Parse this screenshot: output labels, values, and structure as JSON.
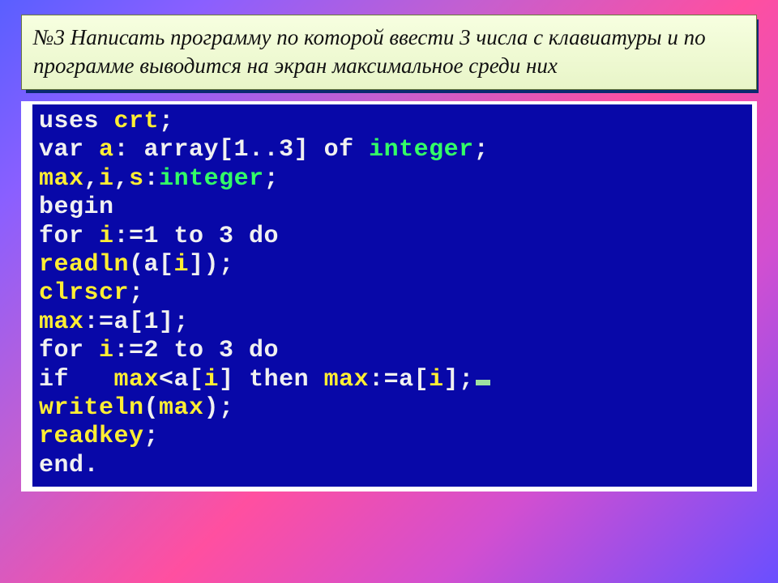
{
  "task": {
    "text": "№3  Написать программу по которой ввести 3 числа с клавиатуры и по программе выводится на экран максимальное среди них"
  },
  "code": {
    "l1_kw1": "uses ",
    "l1_id1": "crt",
    "l1_p": ";",
    "l2_kw1": "var ",
    "l2_id1": "a",
    "l2_kw2": ": array[1..3] of ",
    "l2_typ": "integer",
    "l2_p": ";",
    "l3_id1": "max",
    "l3_p1": ",",
    "l3_id2": "i",
    "l3_p2": ",",
    "l3_id3": "s",
    "l3_p3": ":",
    "l3_typ": "integer",
    "l3_p4": ";",
    "l4_kw": "begin",
    "l5_kw1": "for ",
    "l5_id1": "i",
    "l5_kw2": ":=1 to 3 do",
    "l6_id1": "readln",
    "l6_kw1": "(a[",
    "l6_id2": "i",
    "l6_kw2": "]);",
    "l7_id1": "clrscr",
    "l7_p": ";",
    "l8_id1": "max",
    "l8_kw1": ":=a[1];",
    "l9_kw1": "for ",
    "l9_id1": "i",
    "l9_kw2": ":=2 to 3 do",
    "l10_kw1": "if   ",
    "l10_id1": "max",
    "l10_kw2": "<a[",
    "l10_id2": "i",
    "l10_kw3": "] then ",
    "l10_id3": "max",
    "l10_kw4": ":=a[",
    "l10_id4": "i",
    "l10_kw5": "];",
    "l11_id1": "writeln",
    "l11_kw1": "(",
    "l11_id2": "max",
    "l11_kw2": ");",
    "l12_id1": "readkey",
    "l12_p": ";",
    "l13_kw": "end."
  }
}
